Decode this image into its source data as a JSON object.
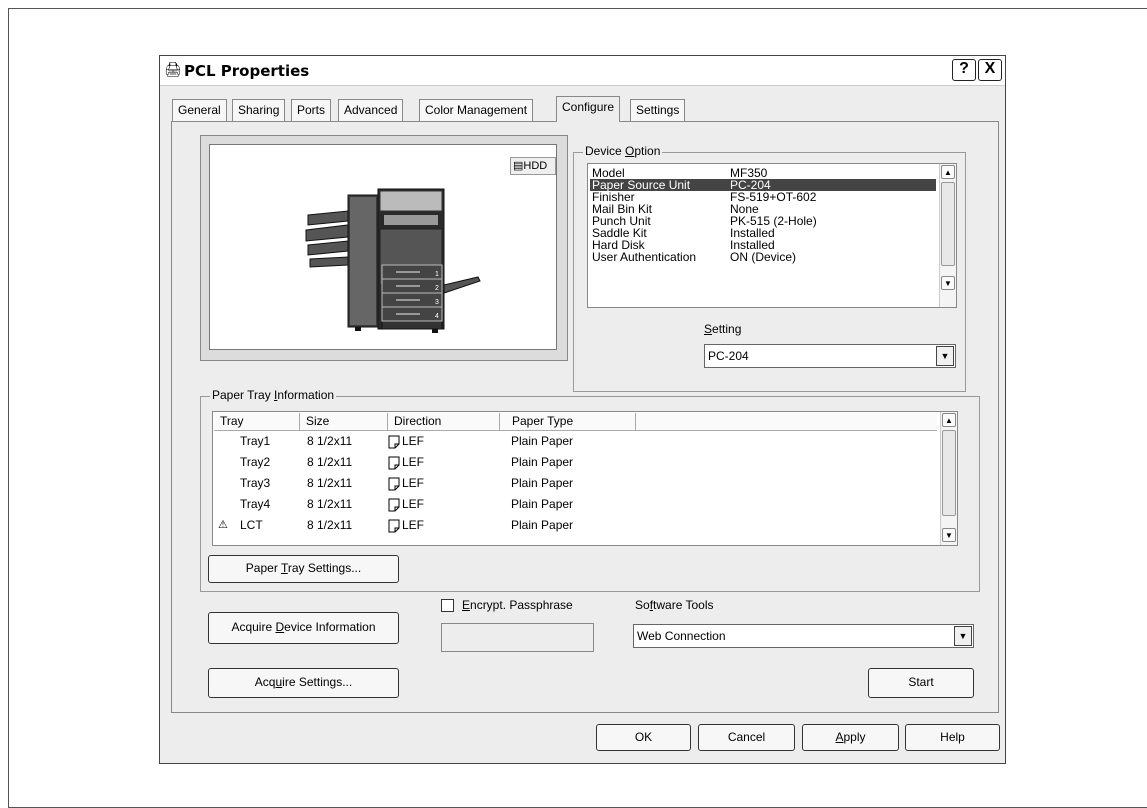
{
  "window": {
    "title": "PCL Properties",
    "help_button": "?",
    "close_button": "X"
  },
  "tabs": [
    {
      "label": "General"
    },
    {
      "label": "Sharing"
    },
    {
      "label": "Ports"
    },
    {
      "label": "Advanced"
    },
    {
      "label": "Color Management"
    },
    {
      "label": "Configure",
      "active": true
    },
    {
      "label": "Settings"
    }
  ],
  "preview": {
    "hdd_badge": "HDD",
    "tray_numbers": [
      "1",
      "2",
      "3",
      "4"
    ]
  },
  "device_option": {
    "label_pre": "Device ",
    "label_ul": "O",
    "label_post": "ption",
    "rows": [
      {
        "name": "Model",
        "value": "MF350"
      },
      {
        "name": "Paper Source Unit",
        "value": "PC-204",
        "selected": true
      },
      {
        "name": "Finisher",
        "value": "FS-519+OT-602"
      },
      {
        "name": "Mail Bin Kit",
        "value": "None"
      },
      {
        "name": "Punch Unit",
        "value": "PK-515 (2-Hole)"
      },
      {
        "name": "Saddle Kit",
        "value": "Installed"
      },
      {
        "name": "Hard Disk",
        "value": "Installed"
      },
      {
        "name": "User Authentication",
        "value": "ON (Device)"
      }
    ],
    "setting_label_ul": "S",
    "setting_label_rest": "etting",
    "setting_value": "PC-204"
  },
  "paper_tray": {
    "label_pre": "Paper Tray ",
    "label_ul": "I",
    "label_post": "nformation",
    "columns": [
      "Tray",
      "Size",
      "Direction",
      "Paper Type"
    ],
    "rows": [
      {
        "tray": "Tray1",
        "size": "8 1/2x11",
        "direction": "LEF",
        "paper_type": "Plain Paper"
      },
      {
        "tray": "Tray2",
        "size": "8 1/2x11",
        "direction": "LEF",
        "paper_type": "Plain Paper"
      },
      {
        "tray": "Tray3",
        "size": "8 1/2x11",
        "direction": "LEF",
        "paper_type": "Plain Paper"
      },
      {
        "tray": "Tray4",
        "size": "8 1/2x11",
        "direction": "LEF",
        "paper_type": "Plain Paper"
      },
      {
        "tray": "LCT",
        "size": "8 1/2x11",
        "direction": "LEF",
        "paper_type": "Plain Paper"
      }
    ],
    "settings_button_pre": "Paper ",
    "settings_button_ul": "T",
    "settings_button_post": "ray Settings..."
  },
  "bottom": {
    "acquire_device_pre": "Acquire ",
    "acquire_device_ul": "D",
    "acquire_device_post": "evice Information",
    "acquire_settings_pre": "Acq",
    "acquire_settings_ul": "u",
    "acquire_settings_post": "ire Settings...",
    "encrypt_ul": "E",
    "encrypt_rest": "ncrypt. Passphrase",
    "encrypt_checked": false,
    "software_tools_pre": "So",
    "software_tools_ul": "f",
    "software_tools_post": "tware Tools",
    "software_tools_value": "Web Connection",
    "start_button": "Start"
  },
  "dialog_buttons": {
    "ok": "OK",
    "cancel": "Cancel",
    "apply_ul": "A",
    "apply_rest": "pply",
    "help": "Help"
  }
}
